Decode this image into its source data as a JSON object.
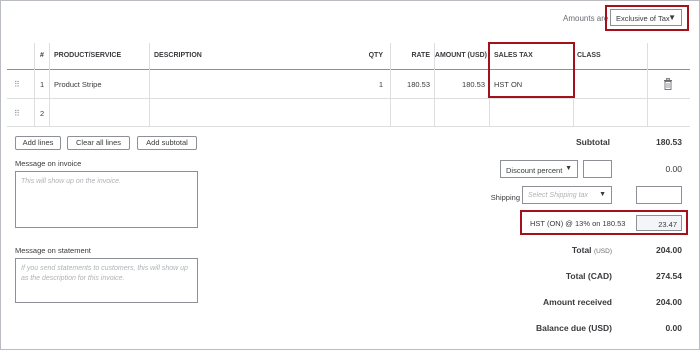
{
  "amounts": {
    "label": "Amounts are",
    "value": "Exclusive of Tax"
  },
  "table": {
    "headers": {
      "num": "#",
      "product": "PRODUCT/SERVICE",
      "description": "DESCRIPTION",
      "qty": "QTY",
      "rate": "RATE",
      "amount": "AMOUNT (USD)",
      "sales_tax": "SALES TAX",
      "class": "CLASS"
    },
    "rows": [
      {
        "num": "1",
        "product": "Product Stripe",
        "description": "",
        "qty": "1",
        "rate": "180.53",
        "amount": "180.53",
        "sales_tax": "HST ON",
        "class": ""
      },
      {
        "num": "2",
        "product": "",
        "description": "",
        "qty": "",
        "rate": "",
        "amount": "",
        "sales_tax": "",
        "class": ""
      }
    ]
  },
  "buttons": {
    "add_lines": "Add lines",
    "clear_all": "Clear all lines",
    "add_subtotal": "Add subtotal"
  },
  "message_invoice": {
    "label": "Message on invoice",
    "placeholder": "This will show up on the invoice."
  },
  "message_statement": {
    "label": "Message on statement",
    "placeholder": "If you send statements to customers, this will show up as the description for this invoice."
  },
  "totals": {
    "subtotal_label": "Subtotal",
    "subtotal_value": "180.53",
    "discount_type": "Discount percent",
    "discount_value": "0.00",
    "shipping_label": "Shipping",
    "shipping_placeholder": "Select Shipping tax",
    "hst_label": "HST (ON) @ 13% on 180.53",
    "hst_value": "23.47",
    "total_label": "Total",
    "total_unit": "(USD)",
    "total_value": "204.00",
    "total_cad_label": "Total (CAD)",
    "total_cad_value": "274.54",
    "amount_received_label": "Amount received",
    "amount_received_value": "204.00",
    "balance_due_label": "Balance due (USD)",
    "balance_due_value": "0.00"
  },
  "colors": {
    "highlight": "#a3111d",
    "border": "#8d9096",
    "text": "#393a3d"
  }
}
